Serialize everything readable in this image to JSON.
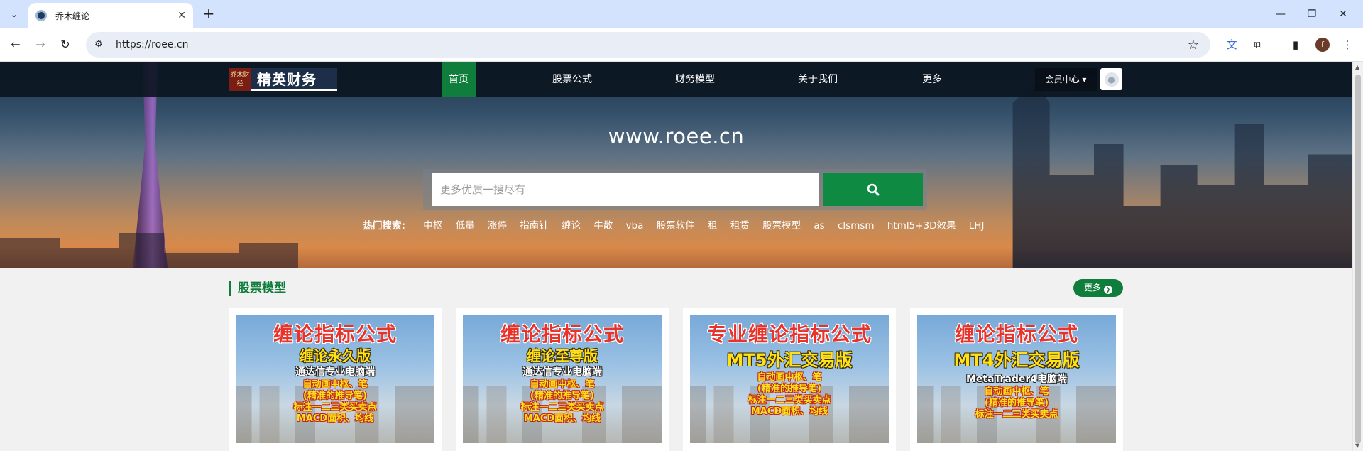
{
  "browser": {
    "tab_title": "乔木缠论",
    "url": "https://roee.cn",
    "new_tab_symbol": "+",
    "close_symbol": "✕",
    "profile_initial": "f"
  },
  "site": {
    "logo_mark": "乔木财经",
    "logo_text": "精英财务",
    "nav": [
      "首页",
      "股票公式",
      "财务模型",
      "关于我们",
      "更多"
    ],
    "member_label": "会员中心 ▾",
    "hero_title": "www.roee.cn",
    "search_placeholder": "更多优质一搜尽有",
    "hot_label": "热门搜索:",
    "hot_items": [
      "中枢",
      "低量",
      "涨停",
      "指南针",
      "缠论",
      "牛散",
      "vba",
      "股票软件",
      "租",
      "租赁",
      "股票模型",
      "as",
      "clsmsm",
      "html5+3D效果",
      "LHJ"
    ]
  },
  "section": {
    "title": "股票模型",
    "more_label": "更多"
  },
  "cards": [
    {
      "title": "缠论指标公式",
      "sub": "缠论永久版",
      "platform": "通达信专业电脑端",
      "features": [
        "自动画中枢、笔",
        "(精准的推导笔)",
        "标注一二三类买卖点",
        "MACD面积、均线"
      ]
    },
    {
      "title": "缠论指标公式",
      "sub": "缠论至尊版",
      "platform": "通达信专业电脑端",
      "features": [
        "自动画中枢、笔",
        "(精准的推导笔)",
        "标注一二三类买卖点",
        "MACD面积、均线"
      ]
    },
    {
      "title": "专业缠论指标公式",
      "sub": "MT5外汇交易版",
      "platform": "",
      "features": [
        "自动画中枢、笔",
        "(精准的推导笔)",
        "标注一二三类买卖点",
        "MACD面积、均线"
      ]
    },
    {
      "title": "缠论指标公式",
      "sub": "MT4外汇交易版",
      "platform": "MetaTrader4电脑端",
      "features": [
        "自动画中枢、笔",
        "(精准的推导笔)",
        "标注一二三类买卖点"
      ]
    }
  ]
}
